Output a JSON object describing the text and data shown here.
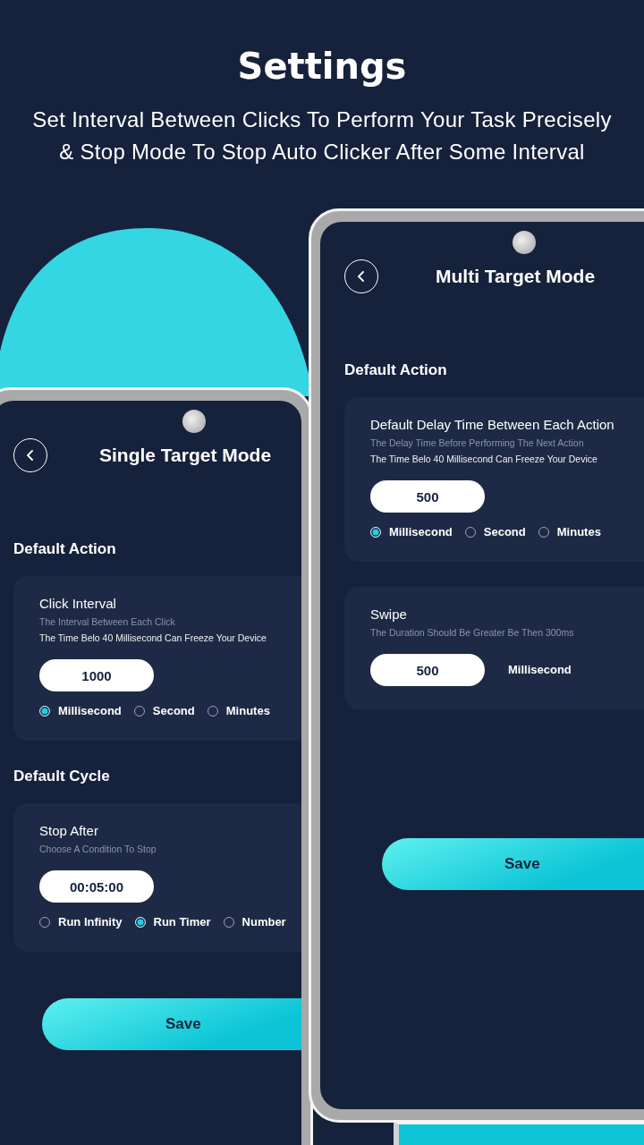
{
  "header": {
    "title": "Settings",
    "subtitle": "Set Interval Between Clicks To Perform Your Task Precisely & Stop Mode To Stop Auto Clicker After Some Interval"
  },
  "phones": [
    {
      "title": "Single Target Mode",
      "sections": [
        {
          "heading": "Default Action",
          "cards": [
            {
              "kind": "options",
              "title": "Click Interval",
              "hint": "The Interval Between Each Click",
              "warning": "The Time Belo 40 Millisecond Can Freeze Your Device",
              "value": "1000",
              "options": [
                {
                  "label": "Millisecond",
                  "selected": true
                },
                {
                  "label": "Second",
                  "selected": false
                },
                {
                  "label": "Minutes",
                  "selected": false
                }
              ]
            }
          ]
        },
        {
          "heading": "Default Cycle",
          "cards": [
            {
              "kind": "options",
              "title": "Stop After",
              "hint": "Choose A Condition To Stop",
              "value": "00:05:00",
              "options": [
                {
                  "label": "Run Infinity",
                  "selected": false
                },
                {
                  "label": "Run Timer",
                  "selected": true
                },
                {
                  "label": "Number",
                  "selected": false
                }
              ]
            }
          ]
        }
      ],
      "save_button": "Save"
    },
    {
      "title": "Multi Target Mode",
      "sections": [
        {
          "heading": "Default Action",
          "cards": [
            {
              "kind": "options",
              "title": "Default Delay Time Between Each Action",
              "hint": "The Delay Time Before Performing The Next Action",
              "warning": "The Time Belo 40 Millisecond Can Freeze Your Device",
              "value": "500",
              "options": [
                {
                  "label": "Millisecond",
                  "selected": true
                },
                {
                  "label": "Second",
                  "selected": false
                },
                {
                  "label": "Minutes",
                  "selected": false
                }
              ]
            },
            {
              "kind": "unit",
              "title": "Swipe",
              "hint": "The Duration Should Be Greater Be Then 300ms",
              "value": "500",
              "unit": "Millisecond"
            }
          ]
        }
      ],
      "save_button": "Save"
    }
  ]
}
